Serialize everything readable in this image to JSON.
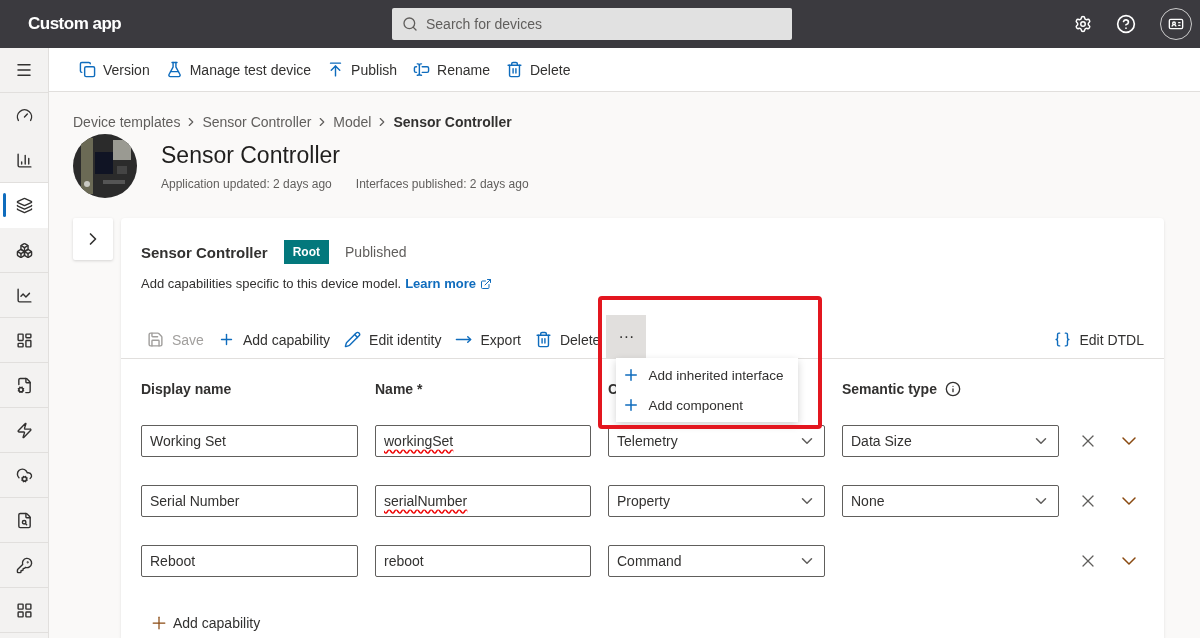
{
  "app": {
    "title": "Custom app",
    "search_placeholder": "Search for devices"
  },
  "sidebar": {
    "items": [
      {
        "selected": false
      },
      {
        "selected": false
      },
      {
        "selected": true
      },
      {
        "selected": false
      },
      {
        "selected": false
      },
      {
        "selected": false
      },
      {
        "selected": false
      },
      {
        "selected": false
      },
      {
        "selected": false
      },
      {
        "selected": false
      },
      {
        "selected": false
      },
      {
        "selected": false
      }
    ]
  },
  "toolbar": [
    "Version",
    "Manage test device",
    "Publish",
    "Rename",
    "Delete"
  ],
  "breadcrumb": {
    "items": [
      "Device templates",
      "Sensor Controller",
      "Model"
    ],
    "current": "Sensor Controller"
  },
  "template": {
    "title": "Sensor Controller",
    "updated": "Application updated: 2 days ago",
    "published": "Interfaces published: 2 days ago"
  },
  "card": {
    "title": "Sensor Controller",
    "badge": "Root",
    "status": "Published",
    "description": "Add capabilities specific to this device model.",
    "link": "Learn more",
    "actions": [
      {
        "label": "Save",
        "disabled": true
      },
      {
        "label": "Add capability",
        "disabled": false
      },
      {
        "label": "Edit identity",
        "disabled": false
      },
      {
        "label": "Export",
        "disabled": false
      },
      {
        "label": "Delete",
        "disabled": false
      }
    ],
    "more": {
      "label": "···",
      "expanded": true,
      "items": [
        "Add inherited interface",
        "Add component"
      ]
    },
    "edit_dtdl": "Edit DTDL",
    "columns": [
      "Display name",
      "Name *",
      "C",
      "Semantic type"
    ],
    "rows": [
      {
        "display_name": "Working Set",
        "name": "workingSet",
        "misspelled": true,
        "capability": "Telemetry",
        "semantic_type": "Data Size"
      },
      {
        "display_name": "Serial Number",
        "name": "serialNumber",
        "misspelled": true,
        "capability": "Property",
        "semantic_type": "None"
      },
      {
        "display_name": "Reboot",
        "name": "reboot",
        "misspelled": false,
        "capability": "Command"
      }
    ],
    "add_capability": "Add capability"
  }
}
